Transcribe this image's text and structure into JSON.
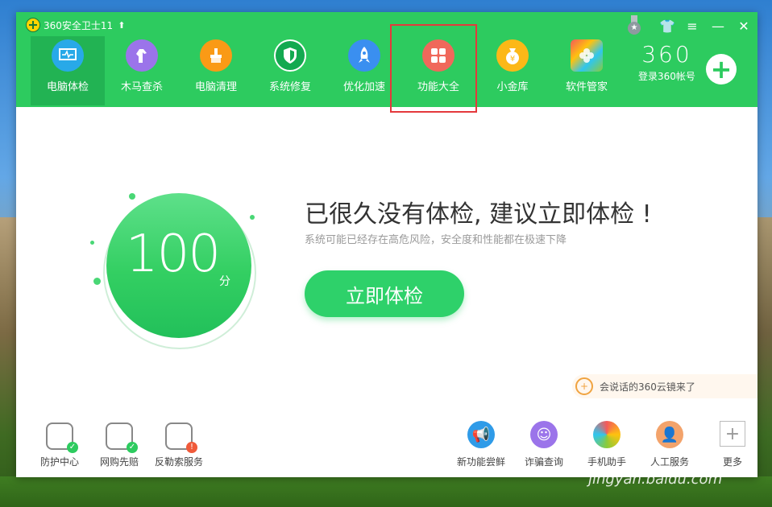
{
  "app": {
    "title": "360安全卫士11",
    "update_icon": "up-arrow-icon"
  },
  "window_controls": [
    "medal-icon",
    "skin-icon",
    "menu-icon",
    "minimize-icon",
    "close-icon"
  ],
  "nav": [
    {
      "label": "电脑体检",
      "icon": "monitor-check-icon",
      "active": true
    },
    {
      "label": "木马查杀",
      "icon": "horse-icon"
    },
    {
      "label": "电脑清理",
      "icon": "broom-icon"
    },
    {
      "label": "系统修复",
      "icon": "shield-icon"
    },
    {
      "label": "优化加速",
      "icon": "rocket-icon"
    },
    {
      "label": "功能大全",
      "icon": "grid-icon",
      "highlighted": true
    },
    {
      "label": "小金库",
      "icon": "money-bag-icon"
    },
    {
      "label": "软件管家",
      "icon": "flower-apps-icon"
    }
  ],
  "brand": {
    "number": "360",
    "login": "登录360帐号"
  },
  "score": {
    "value": "100",
    "unit": "分"
  },
  "main": {
    "title": "已很久没有体检, 建议立即体检 !",
    "subtitle": "系统可能已经存在高危风险，安全度和性能都在极速下降",
    "button": "立即体检"
  },
  "cloud_tip": "会说话的360云镜来了",
  "bottom_left": [
    {
      "label": "防护中心",
      "icon": "shield-check-icon",
      "badge_color": "#2dcb5f",
      "badge": "✓"
    },
    {
      "label": "网购先赔",
      "icon": "cart-icon",
      "badge_color": "#2dcb5f",
      "badge": "✓"
    },
    {
      "label": "反勒索服务",
      "icon": "shield-alert-icon",
      "badge_color": "#f05a3a",
      "badge": "!"
    }
  ],
  "bottom_right": [
    {
      "label": "新功能尝鲜",
      "icon": "megaphone-icon",
      "color": "#2f9be8"
    },
    {
      "label": "诈骗查询",
      "icon": "mask-icon",
      "color": "#9b74ea"
    },
    {
      "label": "手机助手",
      "icon": "phone-flower-icon",
      "color": "#f35a5a"
    },
    {
      "label": "人工服务",
      "icon": "person-icon",
      "color": "#f3a36b"
    },
    {
      "label": "更多",
      "icon": "plus-icon",
      "color": "#bbbbbb"
    }
  ],
  "watermark": "jingyan.baidu.com",
  "colors": {
    "accent": "#2dcb5f",
    "highlight": "#e4393c"
  }
}
